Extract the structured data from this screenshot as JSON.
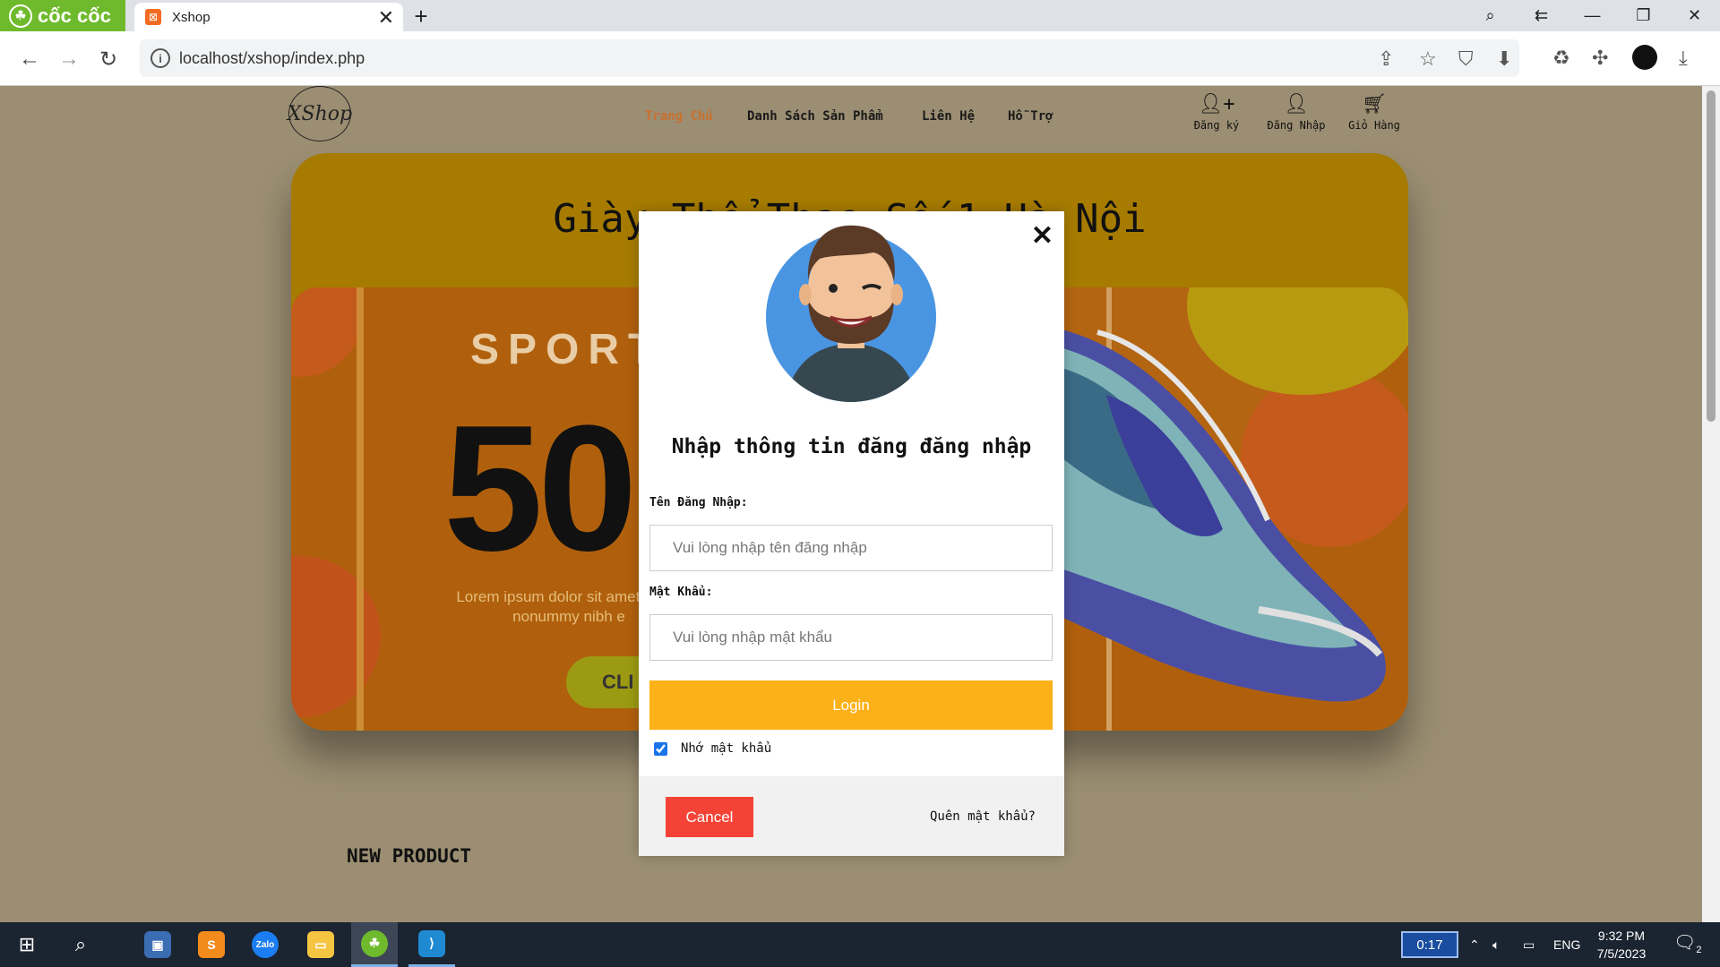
{
  "browser": {
    "brand": "cốc cốc",
    "tab_title": "Xshop",
    "url": "localhost/xshop/index.php"
  },
  "site": {
    "logo_text": "XShop",
    "menu": [
      "Trang Chủ",
      "Danh Sách Sản Phẩm",
      "Liên Hệ",
      "Hỗ Trợ"
    ],
    "header_actions": [
      {
        "label": "Đăng ký",
        "icon": "user-plus-icon"
      },
      {
        "label": "Đăng Nhập",
        "icon": "user-icon"
      },
      {
        "label": "Giỏ Hàng",
        "icon": "cart-icon"
      }
    ],
    "banner_title": "Giày Thể Thao Số 1 Hà Nội",
    "banner_sports": "SPORTS",
    "banner_big": "50",
    "banner_lorem": "Lorem ipsum dolor sit amet, diam nonummy nibh e",
    "banner_click": "CLI",
    "new_product": "NEW PRODUCT"
  },
  "modal": {
    "title": "Nhập thông tin đăng đăng nhập",
    "username_label": "Tên Đăng Nhập:",
    "username_placeholder": "Vui lòng nhập tên đăng nhập",
    "password_label": "Mật Khẩu:",
    "password_placeholder": "Vui lòng nhập mật khẩu",
    "login_label": "Login",
    "remember_label": "Nhớ mật khẩu",
    "remember_checked": true,
    "cancel_label": "Cancel",
    "forgot_label": "Quên mật khẩu?"
  },
  "taskbar": {
    "timer": "0:17",
    "language": "ENG",
    "time": "9:32 PM",
    "date": "7/5/2023",
    "notifications": "2"
  },
  "colors": {
    "accent": "#fbb117",
    "cancel": "#f44336",
    "active_menu": "#c9702f",
    "overlay": "#9b8e72"
  }
}
